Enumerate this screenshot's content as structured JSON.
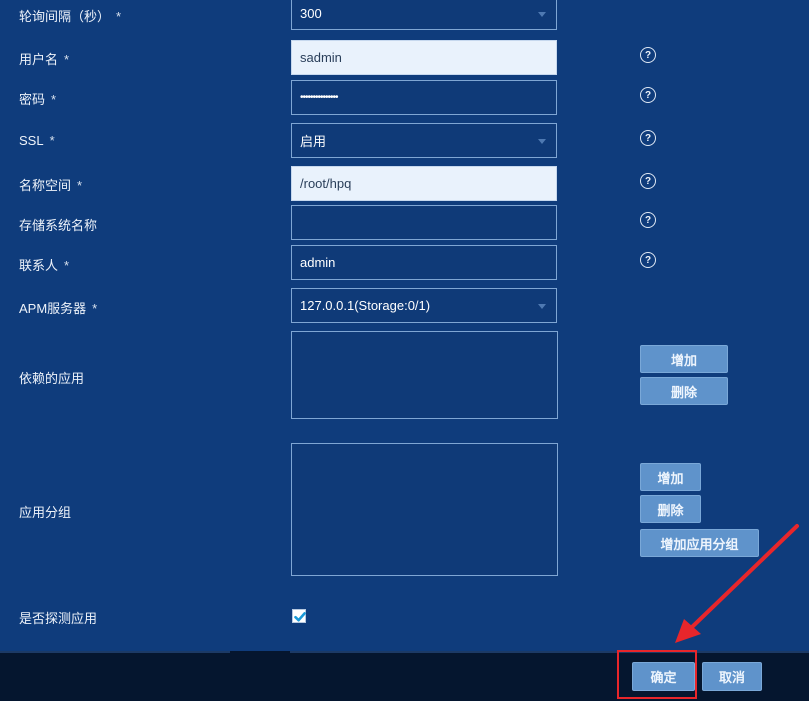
{
  "form": {
    "poll_interval": {
      "label": "轮询间隔（秒）",
      "required": "*",
      "value": "300"
    },
    "username": {
      "label": "用户名",
      "required": "*",
      "value": "sadmin"
    },
    "password": {
      "label": "密码",
      "required": "*",
      "value": "•••••••••••••••"
    },
    "ssl": {
      "label": "SSL",
      "required": "*",
      "value": "启用"
    },
    "namespace": {
      "label": "名称空间",
      "required": "*",
      "value": "/root/hpq"
    },
    "storage_name": {
      "label": "存储系统名称",
      "value": ""
    },
    "contact": {
      "label": "联系人",
      "required": "*",
      "value": "admin"
    },
    "apm_server": {
      "label": "APM服务器",
      "required": "*",
      "value": "127.0.0.1(Storage:0/1)"
    },
    "dependent_apps": {
      "label": "依赖的应用",
      "add_label": "增加",
      "delete_label": "删除"
    },
    "app_group": {
      "label": "应用分组",
      "add_label": "增加",
      "delete_label": "删除",
      "add_group_label": "增加应用分组"
    },
    "detect_app": {
      "label": "是否探测应用",
      "checked": true
    }
  },
  "help_icon_glyph": "?",
  "footer": {
    "confirm_label": "确定",
    "cancel_label": "取消"
  },
  "colors": {
    "background": "#0f3c7c",
    "button": "#5f93cb",
    "highlight": "#e8262b",
    "footer": "#05162f"
  }
}
